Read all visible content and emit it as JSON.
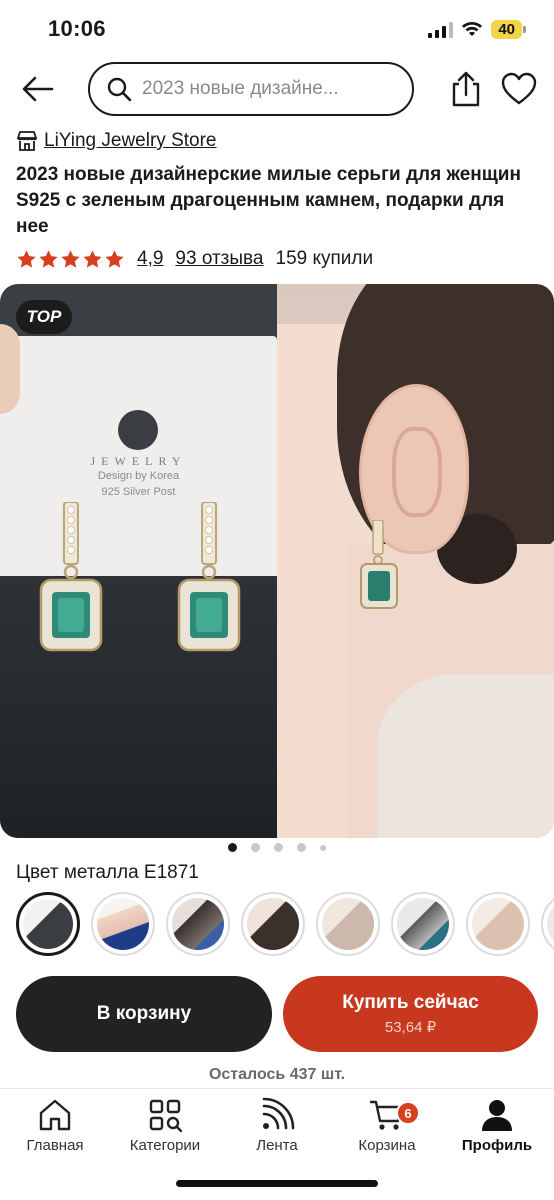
{
  "status_bar": {
    "time": "10:06",
    "battery": "40"
  },
  "header": {
    "search_placeholder": "2023 новые дизайне..."
  },
  "store": {
    "name": "LiYing Jewelry Store"
  },
  "product": {
    "title": "2023 новые дизайнерские милые серьги для женщин S925 с зеленым драгоценным камнем, подарки для нее",
    "rating": "4,9",
    "stars": 5,
    "reviews": "93 отзыва",
    "sold": "159 купили"
  },
  "gallery": {
    "badge": "TOP",
    "card_line1": "JEWELRY",
    "card_line2": "Design by Korea",
    "card_line3": "925 Silver Post",
    "dots_count": 5,
    "active_dot": 0
  },
  "variant": {
    "label": "Цвет металла E1871",
    "swatches_count": 8,
    "selected_index": 0
  },
  "actions": {
    "cart_label": "В корзину",
    "buy_label": "Купить сейчас",
    "buy_price": "53,64 ₽",
    "stock": "Осталось 437 шт."
  },
  "nav": {
    "items": [
      {
        "label": "Главная",
        "icon": "home-icon"
      },
      {
        "label": "Категории",
        "icon": "categories-icon"
      },
      {
        "label": "Лента",
        "icon": "feed-icon"
      },
      {
        "label": "Корзина",
        "icon": "cart-icon",
        "badge": "6"
      },
      {
        "label": "Профиль",
        "icon": "profile-icon"
      }
    ],
    "active_index": 4
  },
  "colors": {
    "accent": "#c7381f",
    "dark_button": "#222222",
    "star": "#d7401f",
    "badge": "#d7401f"
  }
}
